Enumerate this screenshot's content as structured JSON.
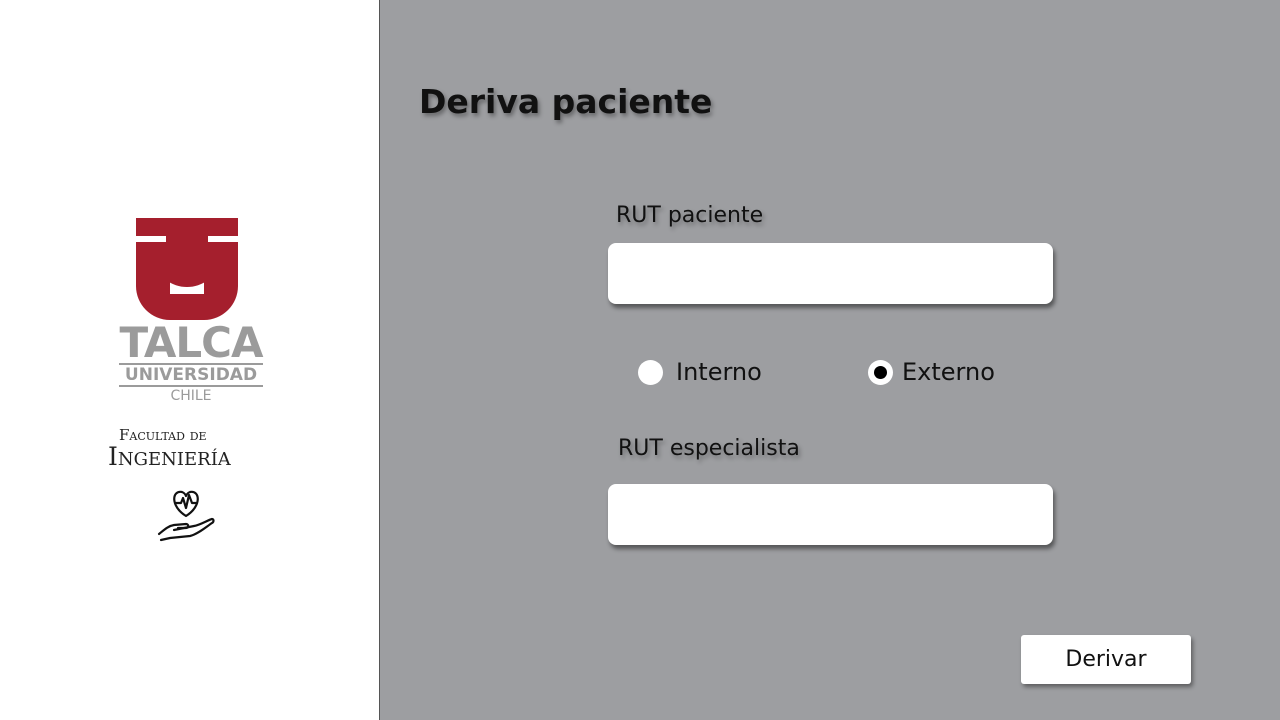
{
  "sidebar": {
    "logo": {
      "line1": "TALCA",
      "line2": "UNIVERSIDAD",
      "line3": "CHILE",
      "brand_color": "#a51f2d"
    },
    "faculty": {
      "line1": "Facultad de",
      "line2": "Ingeniería"
    },
    "icon": "heart-in-hand-icon"
  },
  "main": {
    "title": "Deriva paciente",
    "rut_paciente": {
      "label": "RUT paciente",
      "value": "",
      "placeholder": ""
    },
    "tipo": {
      "options": [
        {
          "label": "Interno",
          "selected": false
        },
        {
          "label": "Externo",
          "selected": true
        }
      ]
    },
    "rut_especialista": {
      "label": "RUT especialista",
      "value": "",
      "placeholder": ""
    },
    "submit_label": "Derivar"
  },
  "colors": {
    "background": "#9d9ea1",
    "sidebar": "#ffffff",
    "logo_red": "#a51f2d",
    "logo_gray": "#9b9b9b"
  }
}
